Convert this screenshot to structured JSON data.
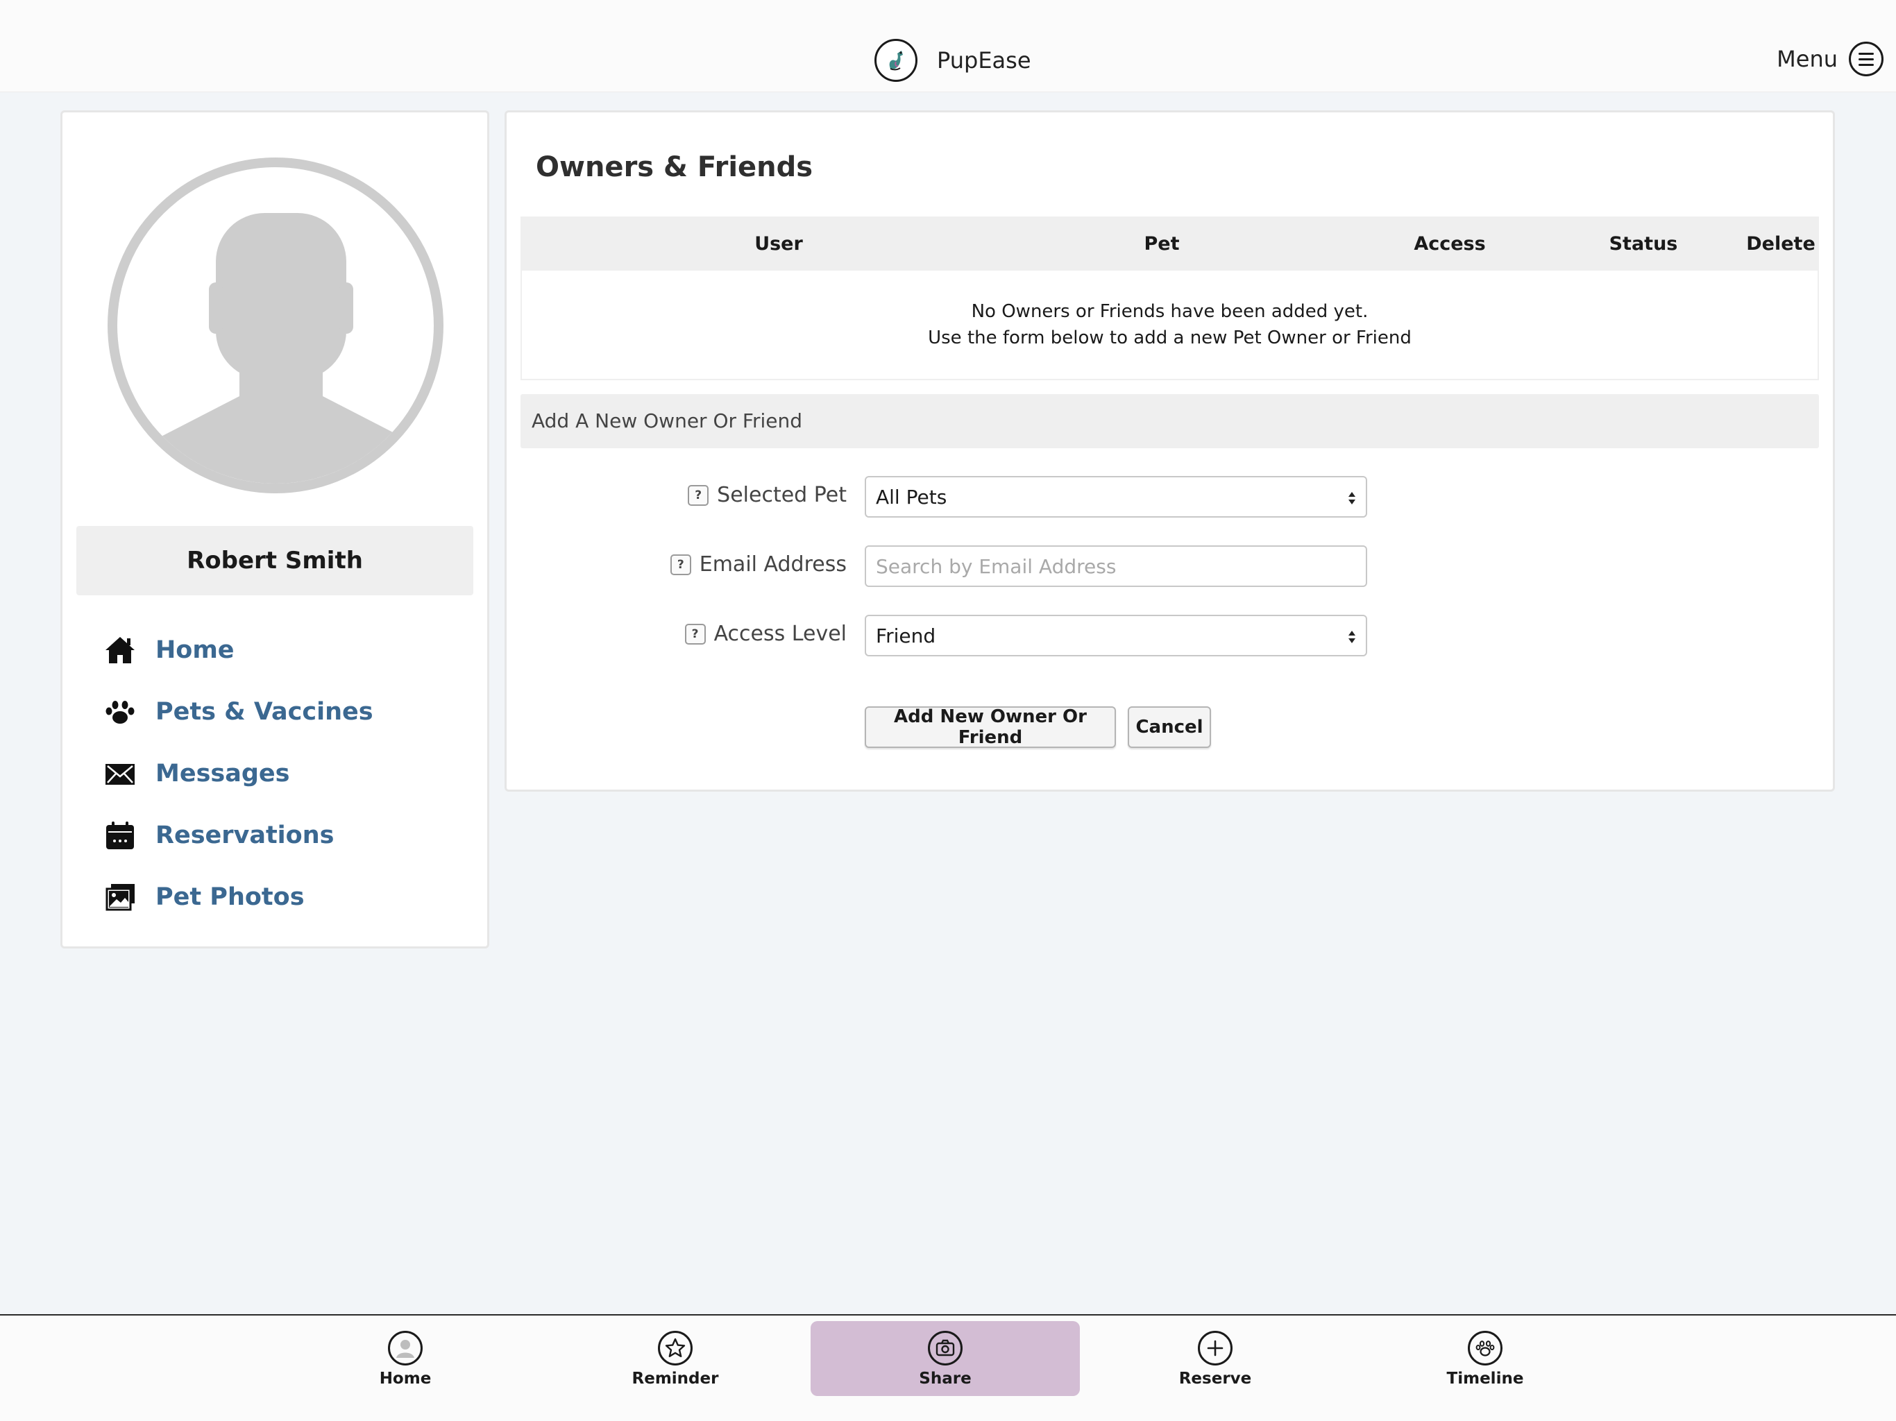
{
  "header": {
    "app_name": "PupEase",
    "menu_label": "Menu"
  },
  "profile": {
    "name": "Robert Smith"
  },
  "sidebar": {
    "items": [
      {
        "label": "Home",
        "icon": "home-icon"
      },
      {
        "label": "Pets & Vaccines",
        "icon": "paw-icon"
      },
      {
        "label": "Messages",
        "icon": "envelope-icon"
      },
      {
        "label": "Reservations",
        "icon": "calendar-icon"
      },
      {
        "label": "Pet Photos",
        "icon": "photos-icon"
      }
    ]
  },
  "main": {
    "title": "Owners & Friends",
    "table": {
      "columns": [
        "User",
        "Pet",
        "Access",
        "Status",
        "Delete"
      ],
      "empty_line1": "No Owners or Friends have been added yet.",
      "empty_line2": "Use the form below to add a new Pet Owner or Friend"
    },
    "form": {
      "heading": "Add A New Owner Or Friend",
      "help_glyph": "?",
      "selected_pet_label": "Selected Pet",
      "selected_pet_value": "All Pets",
      "email_label": "Email Address",
      "email_value": "",
      "email_placeholder": "Search by Email Address",
      "access_label": "Access Level",
      "access_value": "Friend",
      "submit_label": "Add New Owner Or Friend",
      "cancel_label": "Cancel"
    }
  },
  "tabbar": {
    "items": [
      {
        "label": "Home",
        "icon": "user-circle-icon",
        "active": false
      },
      {
        "label": "Reminder",
        "icon": "star-icon",
        "active": false
      },
      {
        "label": "Share",
        "icon": "camera-icon",
        "active": true
      },
      {
        "label": "Reserve",
        "icon": "plus-icon",
        "active": false
      },
      {
        "label": "Timeline",
        "icon": "paw-circle-icon",
        "active": false
      }
    ],
    "active_color": "#d3bdd4"
  },
  "colors": {
    "background": "#f2f5f8",
    "nav_link": "#3b6891",
    "header_bg": "#fbfbfb"
  }
}
